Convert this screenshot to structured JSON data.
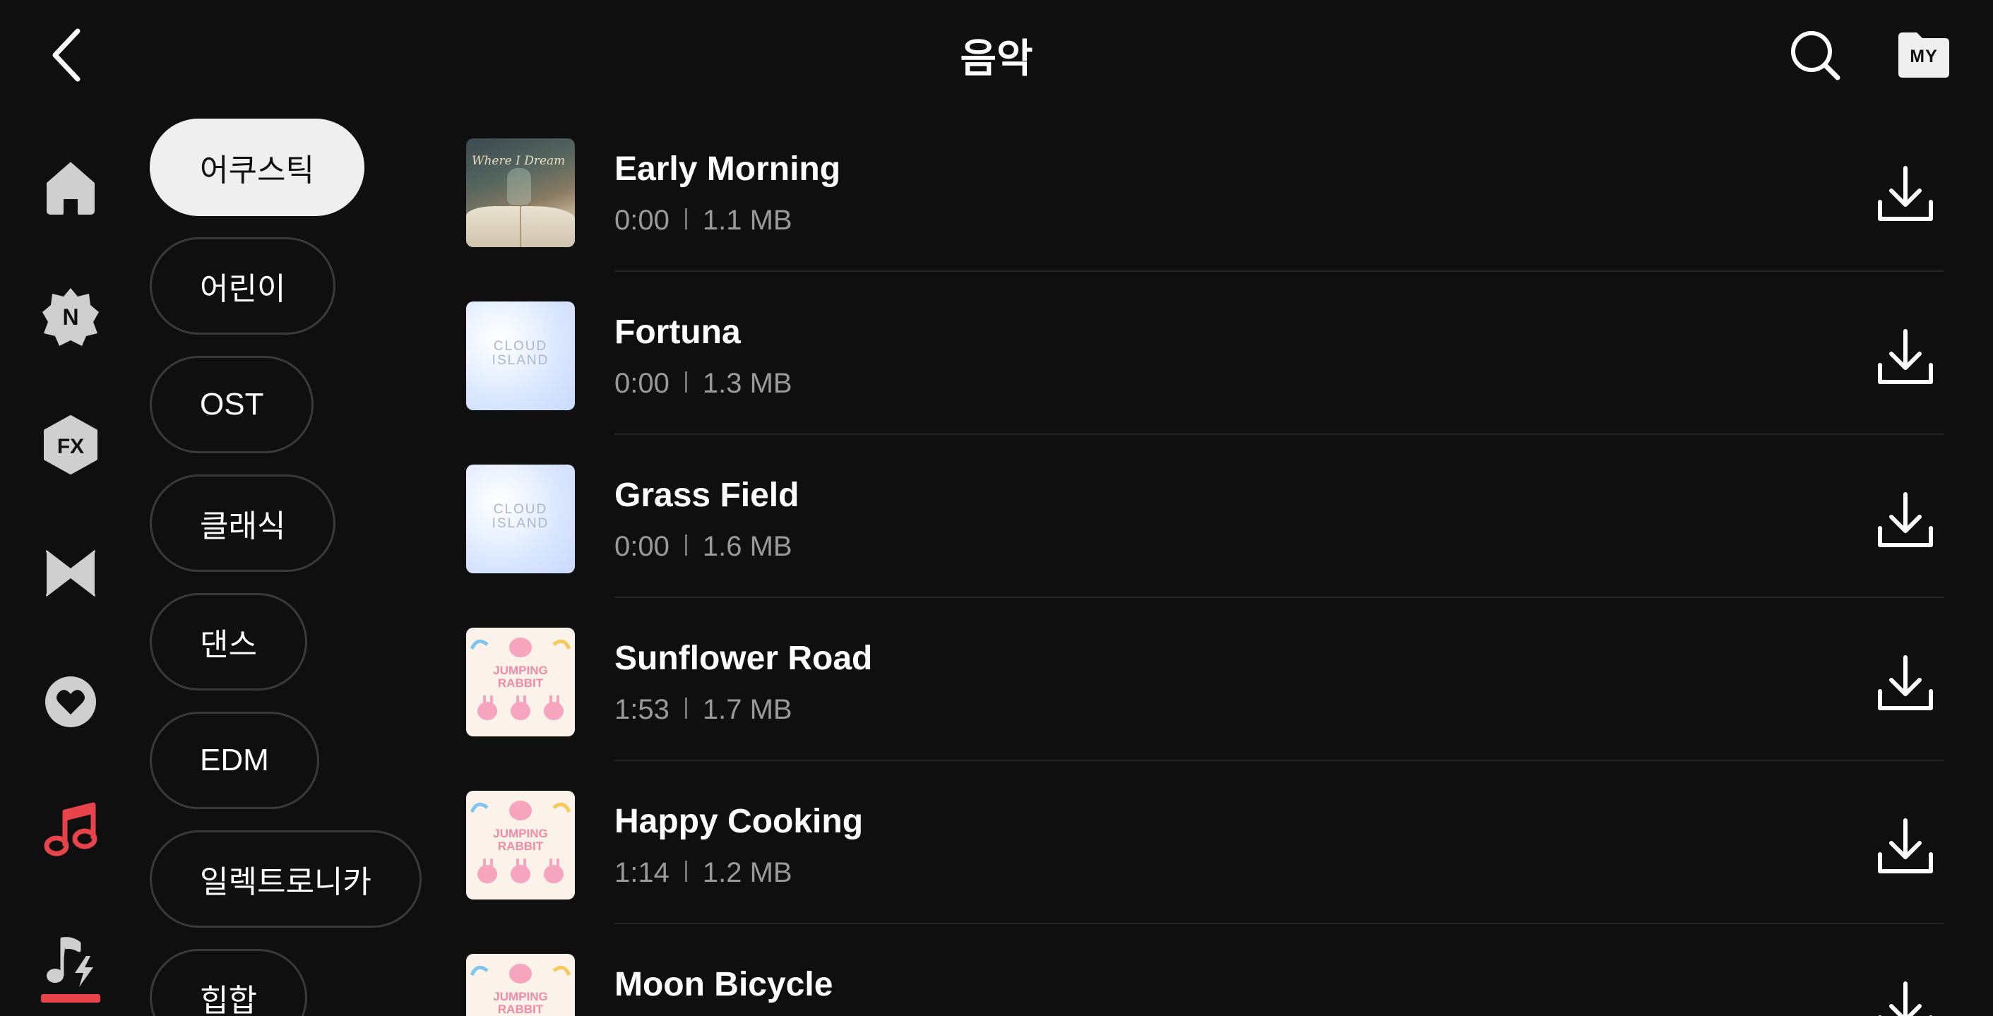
{
  "header": {
    "title": "음악",
    "my_label": "MY"
  },
  "nav": {
    "items": [
      {
        "name": "home",
        "icon": "home-icon"
      },
      {
        "name": "new",
        "icon": "new-badge-icon",
        "label": "N"
      },
      {
        "name": "effects",
        "icon": "fx-icon",
        "label": "FX"
      },
      {
        "name": "transitions",
        "icon": "bowtie-icon"
      },
      {
        "name": "favorites",
        "icon": "heart-icon"
      },
      {
        "name": "music",
        "icon": "music-note-icon",
        "active": true
      },
      {
        "name": "sound-effects",
        "icon": "music-flash-icon"
      }
    ],
    "active_color": "#e8434a"
  },
  "genres": [
    {
      "label": "어쿠스틱",
      "active": true
    },
    {
      "label": "어린이"
    },
    {
      "label": "OST"
    },
    {
      "label": "클래식"
    },
    {
      "label": "댄스"
    },
    {
      "label": "EDM"
    },
    {
      "label": "일렉트로니카"
    },
    {
      "label": "힙합"
    }
  ],
  "tracks": [
    {
      "title": "Early Morning",
      "duration": "0:00",
      "size": "1.1 MB",
      "art": "Where I Dream",
      "art_style": "book"
    },
    {
      "title": "Fortuna",
      "duration": "0:00",
      "size": "1.3 MB",
      "art_line1": "CLOUD",
      "art_line2": "ISLAND",
      "art_style": "cloud"
    },
    {
      "title": "Grass Field",
      "duration": "0:00",
      "size": "1.6 MB",
      "art_line1": "CLOUD",
      "art_line2": "ISLAND",
      "art_style": "cloud"
    },
    {
      "title": "Sunflower Road",
      "duration": "1:53",
      "size": "1.7 MB",
      "art_line1": "JUMPING",
      "art_line2": "RABBIT",
      "art_style": "rabbit"
    },
    {
      "title": "Happy Cooking",
      "duration": "1:14",
      "size": "1.2 MB",
      "art_line1": "JUMPING",
      "art_line2": "RABBIT",
      "art_style": "rabbit"
    },
    {
      "title": "Moon Bicycle",
      "duration": "",
      "size": "",
      "art_line1": "JUMPING",
      "art_line2": "RABBIT",
      "art_style": "rabbit"
    }
  ]
}
